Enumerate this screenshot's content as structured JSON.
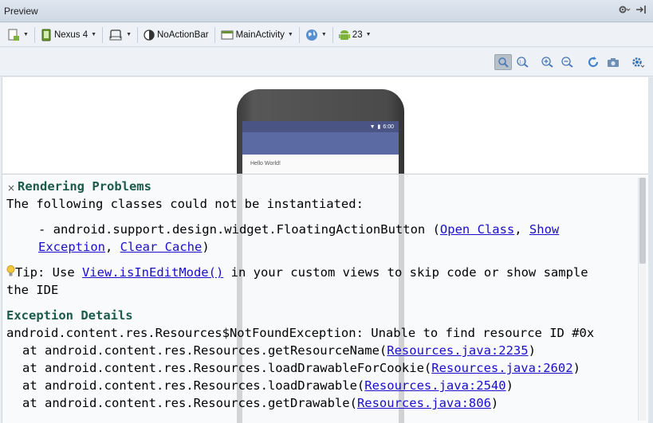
{
  "window": {
    "title": "Preview"
  },
  "toolbar": {
    "device_label": "Nexus 4",
    "theme_label": "NoActionBar",
    "activity_label": "MainActivity",
    "api_level_label": "23"
  },
  "phone": {
    "clock": "6:00",
    "hello_text": "Hello World!"
  },
  "error_panel": {
    "close_glyph": "×",
    "title": "Rendering Problems",
    "intro": "The following classes could not be instantiated:",
    "class_line_prefix": "- android.support.design.widget.FloatingActionButton (",
    "open_class_link": "Open Class",
    "show_exception_link_part1": "Show",
    "show_exception_link_part2": "Exception",
    "clear_cache_link": "Clear Cache",
    "tip_prefix": "Tip: Use ",
    "tip_link": "View.isInEditMode()",
    "tip_suffix": " in your custom views to skip code or show sample",
    "tip_line2": "the IDE",
    "exception_heading": "Exception Details",
    "exception_line": "android.content.res.Resources$NotFoundException: Unable to find resource ID #0x",
    "stack": [
      {
        "prefix": "at android.content.res.Resources.getResourceName(",
        "link": "Resources.java:2235",
        "suffix": ")"
      },
      {
        "prefix": "at android.content.res.Resources.loadDrawableForCookie(",
        "link": "Resources.java:2602",
        "suffix": ")"
      },
      {
        "prefix": "at android.content.res.Resources.loadDrawable(",
        "link": "Resources.java:2540",
        "suffix": ")"
      },
      {
        "prefix": "at android.content.res.Resources.getDrawable(",
        "link": "Resources.java:806",
        "suffix": ")"
      }
    ]
  }
}
